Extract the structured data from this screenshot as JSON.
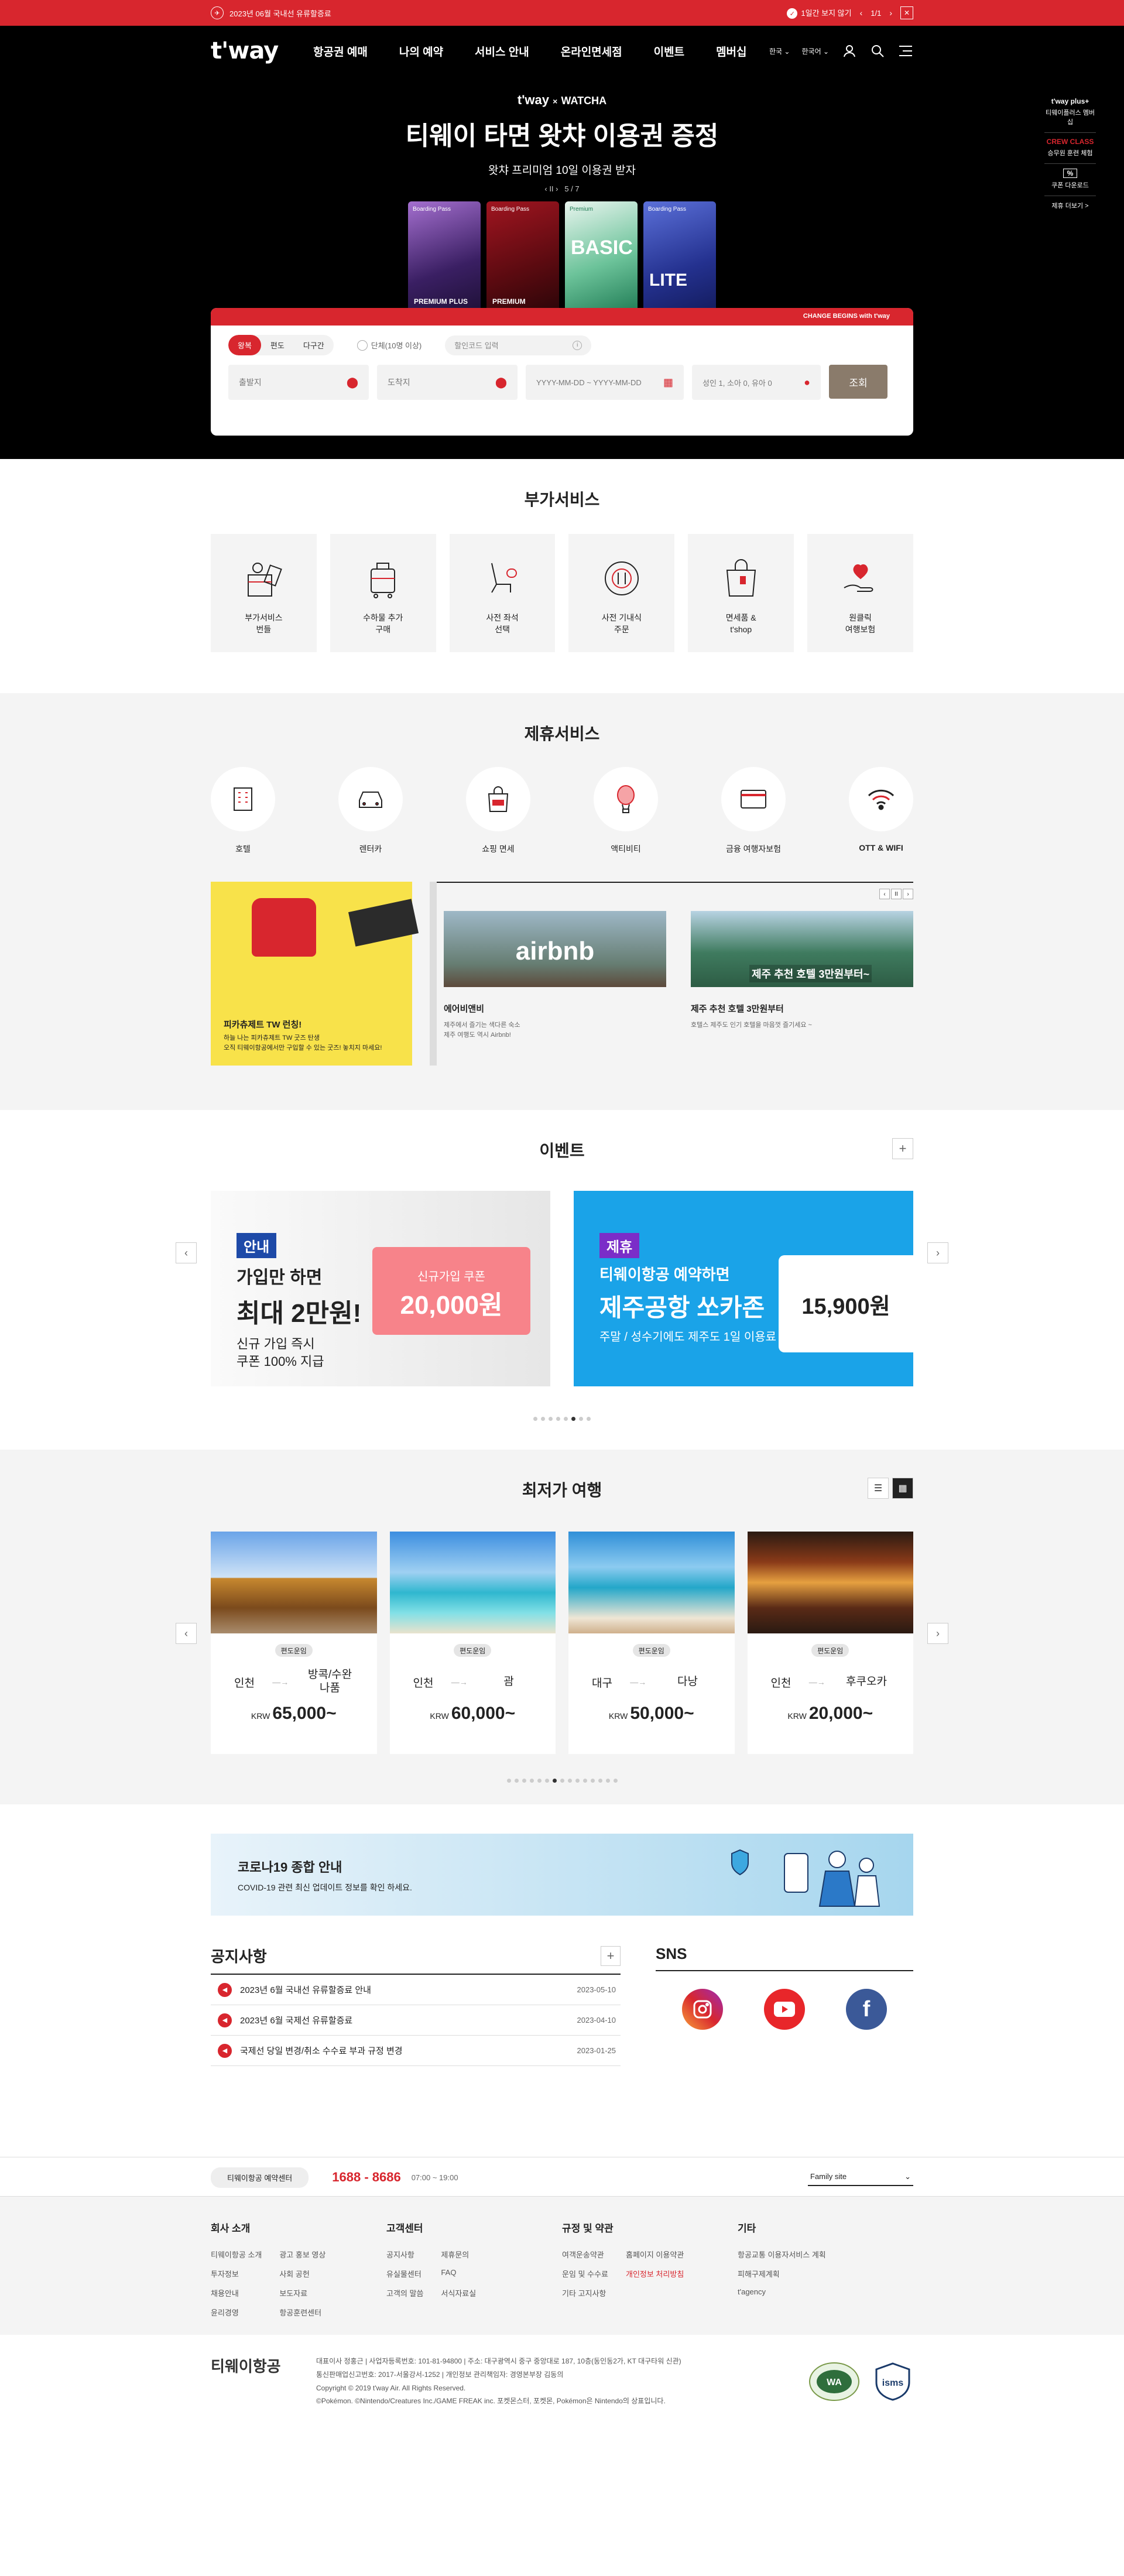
{
  "topbar": {
    "notice": "2023년 06월 국내선 유류할증료",
    "hide_day": "1일간 보지 않기",
    "pager": "1/1",
    "close_icon": "close-icon"
  },
  "header": {
    "logo": "t'way",
    "nav": [
      "항공권 예매",
      "나의 예약",
      "서비스 안내",
      "온라인면세점",
      "이벤트",
      "멤버십"
    ],
    "lang_kr": "한국",
    "lang_ko": "한국어"
  },
  "hero": {
    "brand_tway": "t'way",
    "brand_x": "×",
    "brand_watcha": "WATCHA",
    "title": "티웨이 타면 왓챠 이용권 증정",
    "subtitle": "왓챠 프리미엄 10일 이용권 받자",
    "pager": "5 / 7",
    "cards": [
      {
        "label": "Boarding Pass",
        "name": "PREMIUM PLUS",
        "color": "#5b3a8c"
      },
      {
        "label": "Boarding Pass",
        "name": "PREMIUM",
        "color": "#6d0c12"
      },
      {
        "label": "Premium",
        "name": "BASIC",
        "color": "#2c8e6b"
      },
      {
        "label": "Boarding Pass",
        "name": "LITE",
        "color": "#2c3a9e"
      }
    ]
  },
  "quick": [
    {
      "title": "t'way plus+",
      "text": "티웨이플러스 멤버십"
    },
    {
      "title": "CREW CLASS",
      "text": "승무원 훈련 체험"
    },
    {
      "title": "%",
      "text": "쿠폰 다운로드"
    },
    {
      "title": "",
      "text": "제휴 더보기 >"
    }
  ],
  "booking": {
    "banner": "CHANGE BEGINS with t'way",
    "trip_types": [
      "왕복",
      "편도",
      "다구간"
    ],
    "group": "단체(10명 이상)",
    "promo_placeholder": "할인코드 입력",
    "origin": "출발지",
    "destination": "도착지",
    "date_from": "YYYY-MM-DD",
    "date_sep": "~",
    "date_to": "YYYY-MM-DD",
    "pax": "성인 1, 소아 0, 유아 0",
    "search": "조회"
  },
  "addon": {
    "title": "부가서비스",
    "items": [
      "부가서비스\n번들",
      "수하물 추가\n구매",
      "사전 좌석\n선택",
      "사전 기내식\n주문",
      "면세품 &\nt'shop",
      "원클릭\n여행보험"
    ]
  },
  "partner": {
    "title": "제휴서비스",
    "items": [
      "호텔",
      "렌터카",
      "쇼핑 면세",
      "액티비티",
      "금융 여행자보험",
      "OTT & WIFI"
    ],
    "featured_title": "피카츄제트 TW 런칭!",
    "featured_desc": "하늘 나는 피카츄제트 TW 굿즈 탄생\n오직 티웨이항공에서만 구입할 수 있는 굿즈! 놓치지 마세요!",
    "pager_mid": "II",
    "cards": [
      {
        "img_text": "airbnb",
        "title": "에어비앤비",
        "desc": "제주에서 즐기는 색다른 숙소\n제주 여행도 역시 Airbnb!"
      },
      {
        "img_text": "제주 추천 호텔 3만원부터~",
        "title": "제주 추천 호텔 3만원부터",
        "desc": "호텔스 제주도 인기 호텔을 마음껏 즐기세요 ~"
      }
    ]
  },
  "event": {
    "title": "이벤트",
    "banners": [
      {
        "tag": "안내",
        "line1": "가입만 하면",
        "line2": "최대 2만원!",
        "line3": "신규 가입 즉시\n쿠폰 100% 지급",
        "coupon_label": "신규가입 쿠폰",
        "coupon_value": "20,000원"
      },
      {
        "tag": "제휴",
        "line1": "티웨이항공 예약하면",
        "line2": "제주공항 쏘카존",
        "line3": "주말 / 성수기에도\n제주도 1일 이용료 15,900원!",
        "price": "15,900원"
      }
    ],
    "dot_count": 8,
    "active_dot": 5
  },
  "lowest": {
    "title": "최저가 여행",
    "tours": [
      {
        "badge": "편도운임",
        "from": "인천",
        "to": "방콕/수완나품",
        "currency": "KRW",
        "price": "65,000~"
      },
      {
        "badge": "편도운임",
        "from": "인천",
        "to": "괌",
        "currency": "KRW",
        "price": "60,000~"
      },
      {
        "badge": "편도운임",
        "from": "대구",
        "to": "다낭",
        "currency": "KRW",
        "price": "50,000~"
      },
      {
        "badge": "편도운임",
        "from": "인천",
        "to": "후쿠오카",
        "currency": "KRW",
        "price": "20,000~"
      }
    ],
    "dot_count": 15,
    "active_dot": 6
  },
  "covid": {
    "title": "코로나19 종합 안내",
    "desc": "COVID-19 관련 최신 업데이트 정보를 확인 하세요."
  },
  "notice": {
    "title": "공지사항",
    "rows": [
      {
        "text": "2023년 6월 국내선 유류할증료 안내",
        "date": "2023-05-10"
      },
      {
        "text": "2023년 6월 국제선 유류할증료",
        "date": "2023-04-10"
      },
      {
        "text": "국제선 당일 변경/취소 수수료 부과 규정 변경",
        "date": "2023-01-25"
      }
    ]
  },
  "sns": {
    "title": "SNS",
    "icons": [
      "instagram-icon",
      "youtube-icon",
      "facebook-icon"
    ]
  },
  "contact": {
    "label": "티웨이항공 예약센터",
    "phone": "1688 - 8686",
    "hours": "07:00 ~ 19:00",
    "family": "Family site"
  },
  "sitemap": [
    {
      "title": "회사 소개",
      "links": [
        "티웨이항공 소개",
        "광고 홍보 영상",
        "투자정보",
        "사회 공헌",
        "채용안내",
        "보도자료",
        "윤리경영",
        "항공훈련센터"
      ]
    },
    {
      "title": "고객센터",
      "links": [
        "공지사항",
        "제휴문의",
        "유실물센터",
        "FAQ",
        "고객의 말씀",
        "서식자료실"
      ]
    },
    {
      "title": "규정 및 약관",
      "links": [
        "여객운송약관",
        "홈페이지 이용약관",
        "운임 및 수수료",
        "개인정보 처리방침",
        "기타 고지사항"
      ]
    },
    {
      "title": "기타",
      "links": [
        "항공교통 이용자서비스 계획",
        "피해구제계획",
        "t'agency"
      ]
    }
  ],
  "footer": {
    "logo": "티웨이항공",
    "line1": "대표이사 정홍근    |    사업자등록번호: 101-81-94800    |    주소: 대구광역시 중구 중앙대로 187, 10층(동인동2가, KT 대구타워 신관)",
    "line2": "통신판매업신고번호: 2017-서울강서-1252    |    개인정보 관리책임자: 경영본부장 김동의",
    "line3": "Copyright © 2019 t'way Air. All Rights Reserved.",
    "line4": "©Pokémon. ©Nintendo/Creatures Inc./GAME FREAK inc. 포켓몬스터, 포켓몬, Pokémon은 Nintendo의 상표입니다."
  }
}
